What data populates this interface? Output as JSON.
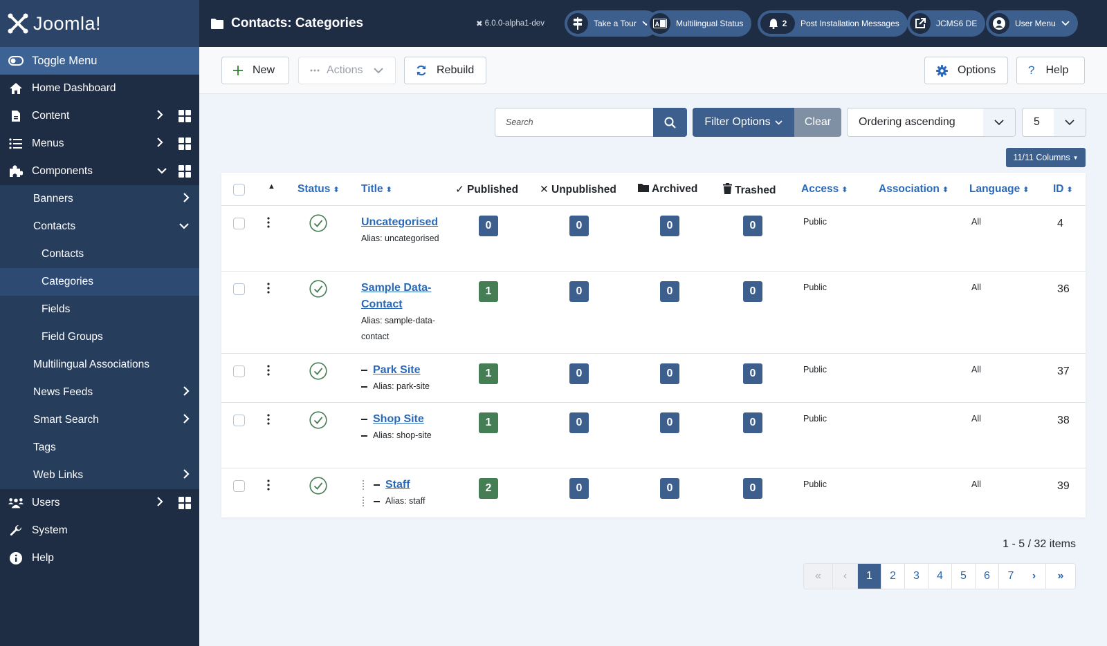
{
  "brand": {
    "name": "Joomla!"
  },
  "header": {
    "title": "Contacts: Categories",
    "version": "6.0.0-alpha1-dev",
    "pills": [
      {
        "label": "Take a Tour",
        "icon": "signpost-icon",
        "has_caret": true
      },
      {
        "label": "Multilingual Status",
        "icon": "language-icon"
      },
      {
        "label": "Post Installation Messages",
        "icon": "bell-icon",
        "count": "2"
      },
      {
        "label": "JCMS6 DE",
        "icon": "external-link-icon"
      },
      {
        "label": "User Menu",
        "icon": "user-circle-icon",
        "has_caret": true
      }
    ]
  },
  "sidebar": {
    "toggle": "Toggle Menu",
    "items": [
      {
        "label": "Home Dashboard"
      },
      {
        "label": "Content"
      },
      {
        "label": "Menus"
      },
      {
        "label": "Components"
      },
      {
        "label": "Users"
      },
      {
        "label": "System"
      },
      {
        "label": "Help"
      }
    ],
    "components": [
      {
        "label": "Banners"
      },
      {
        "label": "Contacts"
      },
      {
        "label": "Multilingual Associations"
      },
      {
        "label": "News Feeds"
      },
      {
        "label": "Smart Search"
      },
      {
        "label": "Tags"
      },
      {
        "label": "Web Links"
      }
    ],
    "contacts_sub": [
      {
        "label": "Contacts"
      },
      {
        "label": "Categories"
      },
      {
        "label": "Fields"
      },
      {
        "label": "Field Groups"
      }
    ]
  },
  "toolbar": {
    "new": "New",
    "actions": "Actions",
    "rebuild": "Rebuild",
    "options": "Options",
    "help": "Help"
  },
  "filters": {
    "search_placeholder": "Search",
    "filter_options": "Filter Options",
    "clear": "Clear",
    "ordering": "Ordering ascending",
    "limit": "5",
    "columns": "11/11 Columns"
  },
  "table": {
    "headers": {
      "status": "Status",
      "title": "Title",
      "published": "Published",
      "unpublished": "Unpublished",
      "archived": "Archived",
      "trashed": "Trashed",
      "access": "Access",
      "association": "Association",
      "language": "Language",
      "id": "ID"
    },
    "rows": [
      {
        "title": "Uncategorised",
        "alias": "Alias: uncategorised",
        "level": 1,
        "published": "0",
        "unpublished": "0",
        "archived": "0",
        "trashed": "0",
        "access": "Public",
        "language": "All",
        "id": "4"
      },
      {
        "title": "Sample Data-Contact",
        "alias": "Alias: sample-data-contact",
        "level": 1,
        "published": "1",
        "unpublished": "0",
        "archived": "0",
        "trashed": "0",
        "access": "Public",
        "language": "All",
        "id": "36"
      },
      {
        "title": "Park Site",
        "alias": "Alias: park-site",
        "level": 2,
        "published": "1",
        "unpublished": "0",
        "archived": "0",
        "trashed": "0",
        "access": "Public",
        "language": "All",
        "id": "37"
      },
      {
        "title": "Shop Site",
        "alias": "Alias: shop-site",
        "level": 2,
        "published": "1",
        "unpublished": "0",
        "archived": "0",
        "trashed": "0",
        "access": "Public",
        "language": "All",
        "id": "38"
      },
      {
        "title": "Staff",
        "alias": "Alias: staff",
        "level": 3,
        "published": "2",
        "unpublished": "0",
        "archived": "0",
        "trashed": "0",
        "access": "Public",
        "language": "All",
        "id": "39"
      }
    ]
  },
  "pagination": {
    "summary": "1 - 5 / 32 items",
    "pages": [
      "1",
      "2",
      "3",
      "4",
      "5",
      "6",
      "7"
    ],
    "current": "1"
  },
  "colors": {
    "sidebar_bg": "#1f2d44",
    "accent": "#3d5f8e",
    "link": "#2a69b8",
    "published_green": "#457d54"
  }
}
